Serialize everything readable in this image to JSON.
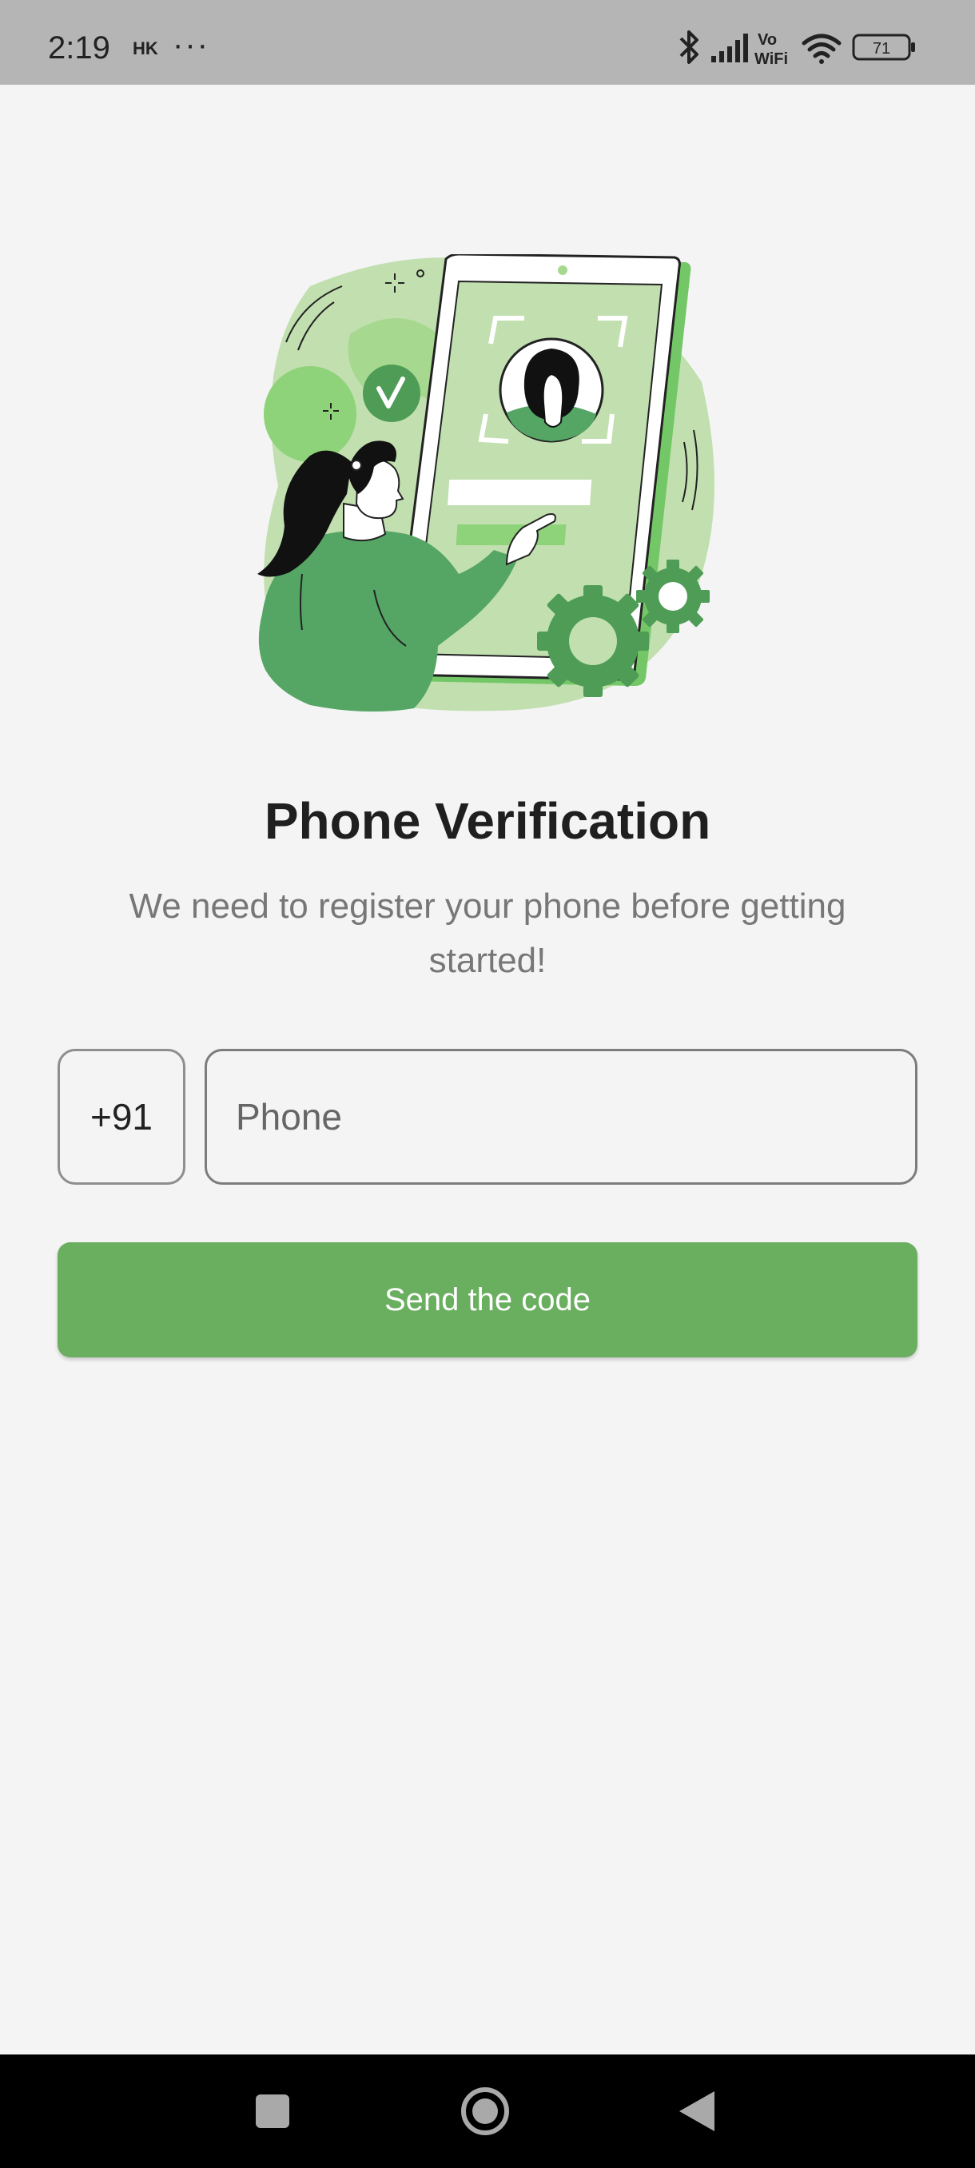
{
  "status_bar": {
    "time": "2:19",
    "carrier": "HK",
    "more": "···",
    "battery_level": "71",
    "vowifi_top": "Vo",
    "vowifi_bottom": "WiFi",
    "icons": [
      "bluetooth-icon",
      "signal-icon",
      "vowifi-icon",
      "wifi-icon",
      "battery-icon"
    ]
  },
  "illustration": {
    "name": "phone-verification-illustration",
    "colors": {
      "light_green": "#c2dfb0",
      "bright_green": "#8ed37a",
      "dark_green": "#55a665",
      "gear_green": "#4e9c55"
    }
  },
  "main": {
    "title": "Phone Verification",
    "subtitle": "We need to register your phone before getting started!"
  },
  "form": {
    "country_code": "+91",
    "phone_placeholder": "Phone",
    "phone_value": "",
    "send_label": "Send the code"
  },
  "nav_bar": {
    "buttons": [
      "recents-icon",
      "home-icon",
      "back-icon"
    ]
  },
  "theme": {
    "accent": "#6aae5f",
    "background": "#f4f4f4",
    "status_bar_bg": "#b5b5b5",
    "nav_bar_bg": "#000000"
  }
}
